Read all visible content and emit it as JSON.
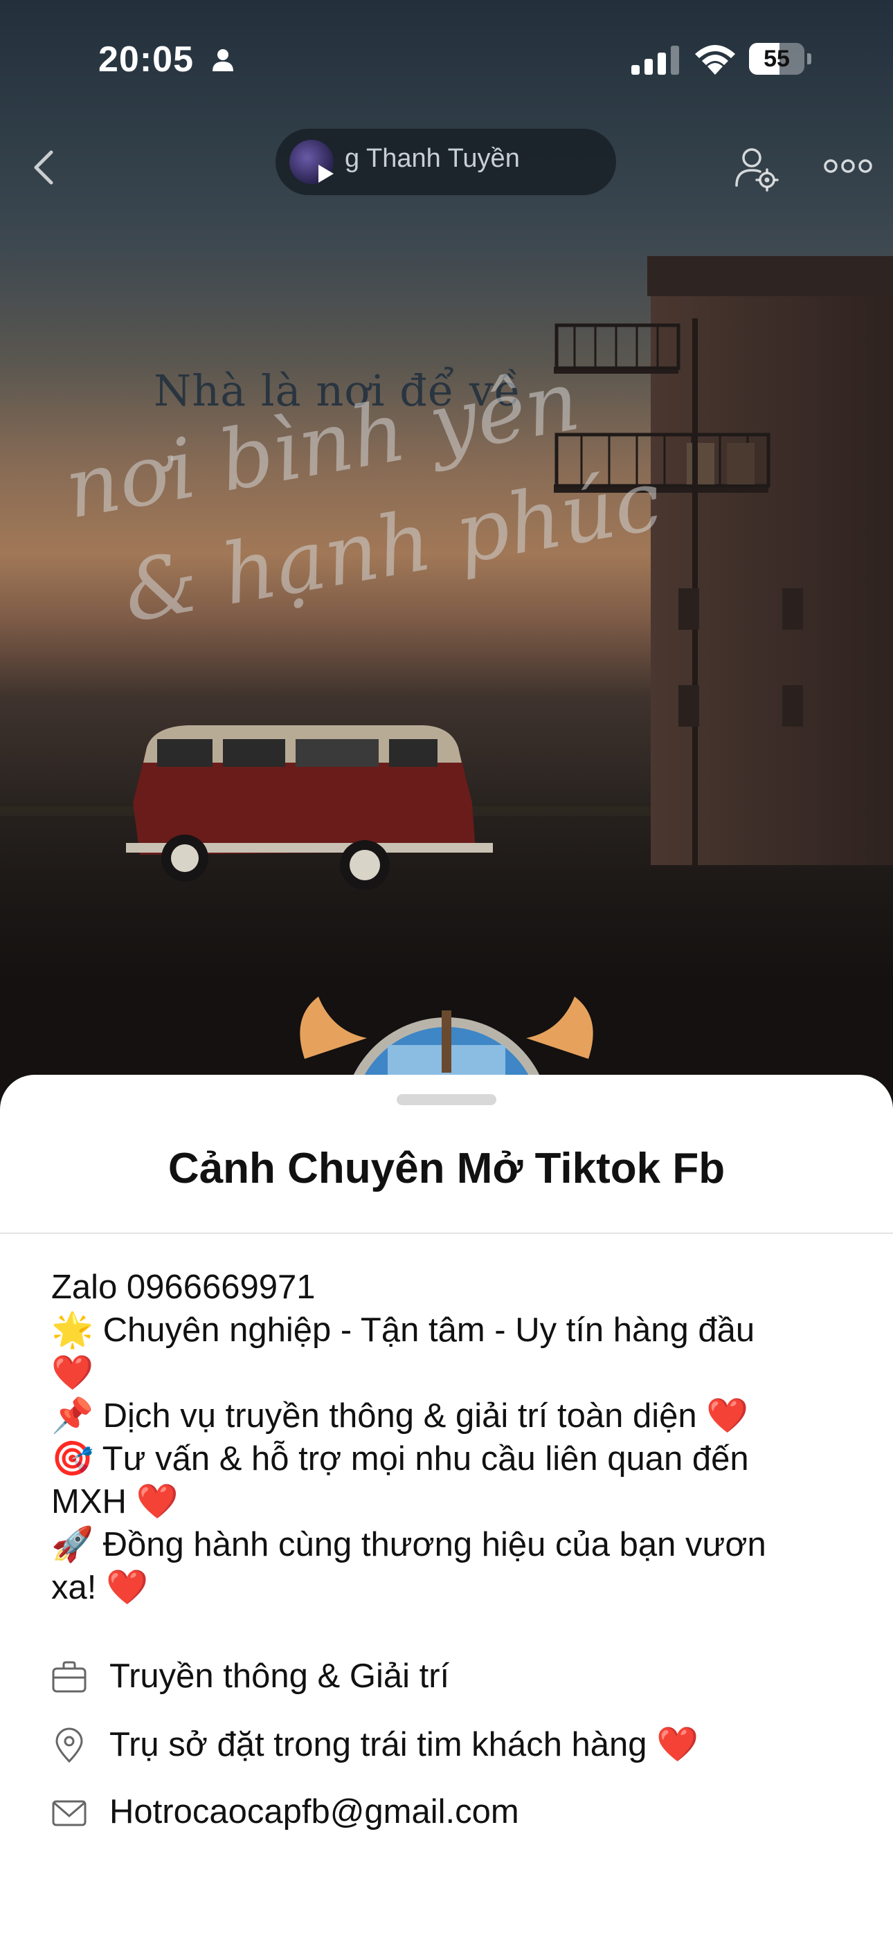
{
  "status_bar": {
    "time": "20:05",
    "battery": "55",
    "battery_level": 0.55
  },
  "header": {
    "music_text": "g Thanh Tuyền"
  },
  "cover": {
    "line1": "Nhà là nơi để về",
    "line2": "nơi bình yên",
    "line3": "& hạnh phúc"
  },
  "profile": {
    "name": "Cảnh Chuyên Mở Tiktok Fb",
    "bio": [
      "Zalo 0966669971",
      "🌟 Chuyên nghiệp - Tận tâm - Uy tín hàng đầu",
      "❤️",
      "📌 Dịch vụ truyền thông & giải trí toàn diện ❤️",
      "🎯 Tư vấn & hỗ trợ mọi nhu cầu liên quan đến",
      "MXH ❤️",
      "🚀 Đồng hành cùng thương hiệu của bạn vươn",
      "xa! ❤️"
    ],
    "category": "Truyền thông & Giải trí",
    "location": "Trụ sở đặt trong trái tim khách hàng ❤️",
    "email": "Hotrocaocapfb@gmail.com"
  },
  "icons": {
    "category": "briefcase-icon",
    "location": "location-pin-icon",
    "email": "mail-icon"
  }
}
